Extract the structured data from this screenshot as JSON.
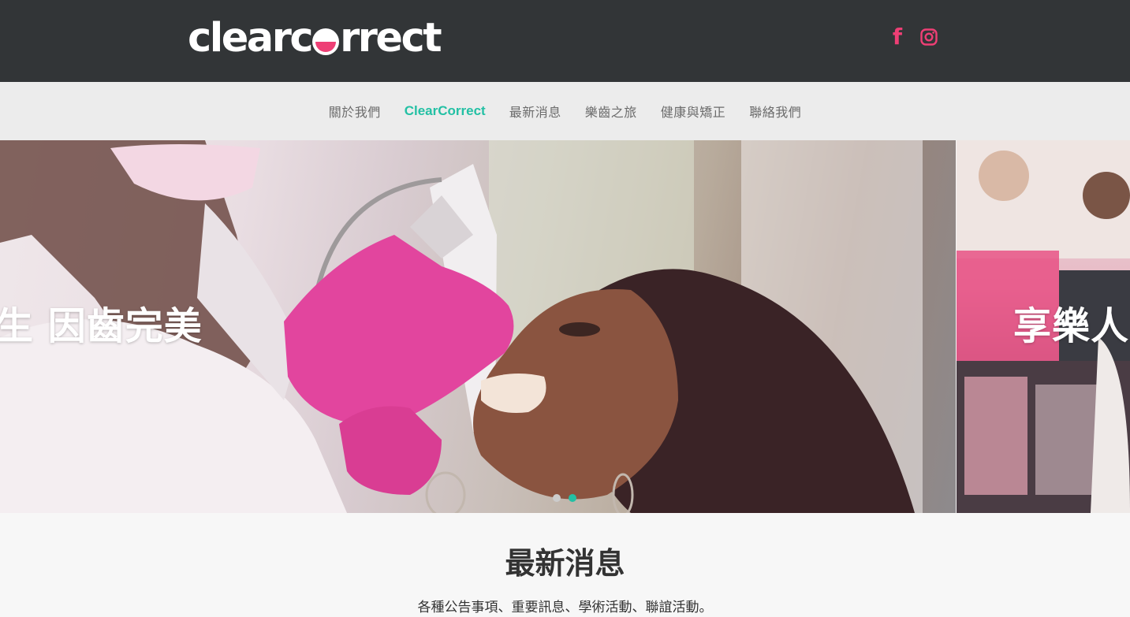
{
  "header": {
    "logo": {
      "prefix": "clearc",
      "suffix": "rrect"
    },
    "social": [
      {
        "name": "facebook",
        "icon": "facebook-icon",
        "glyph": "f"
      },
      {
        "name": "instagram",
        "icon": "instagram-icon"
      }
    ],
    "brand_color": "#ee3f75",
    "background": "#323537"
  },
  "nav": {
    "items": [
      {
        "label": "關於我們"
      },
      {
        "label": "ClearCorrect",
        "active": true
      },
      {
        "label": "最新消息"
      },
      {
        "label": "樂齒之旅"
      },
      {
        "label": "健康與矯正"
      },
      {
        "label": "聯絡我們"
      }
    ],
    "active_color": "#23c0a4"
  },
  "hero": {
    "slides": [
      {
        "caption": "生 因齒完美"
      },
      {
        "caption": "享樂人"
      }
    ],
    "dots": [
      {
        "active": false
      },
      {
        "active": true
      }
    ]
  },
  "news": {
    "title": "最新消息",
    "subtitle": "各種公告事項、重要訊息、學術活動、聯誼活動。"
  }
}
